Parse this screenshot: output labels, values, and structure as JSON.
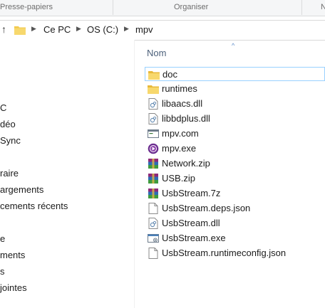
{
  "ribbon": {
    "groups": [
      "Presse-papiers",
      "Organiser",
      "N"
    ]
  },
  "address": {
    "up_glyph": "↑",
    "crumbs": [
      "Ce PC",
      "OS (C:)",
      "mpv"
    ]
  },
  "nav": {
    "items": [
      "C",
      "déo",
      "Sync",
      "raire",
      "argements",
      "cements récents",
      "e",
      "ments",
      "s",
      "jointes"
    ]
  },
  "column": {
    "name_header": "Nom",
    "sort_glyph": "^"
  },
  "files": [
    {
      "name": "doc",
      "icon": "folder-icon",
      "selected": true
    },
    {
      "name": "runtimes",
      "icon": "folder-icon",
      "selected": false
    },
    {
      "name": "libaacs.dll",
      "icon": "dll-file-icon",
      "selected": false
    },
    {
      "name": "libbdplus.dll",
      "icon": "dll-file-icon",
      "selected": false
    },
    {
      "name": "mpv.com",
      "icon": "console-app-icon",
      "selected": false
    },
    {
      "name": "mpv.exe",
      "icon": "mpv-app-icon",
      "selected": false
    },
    {
      "name": "Network.zip",
      "icon": "archive-icon",
      "selected": false
    },
    {
      "name": "USB.zip",
      "icon": "archive-icon",
      "selected": false
    },
    {
      "name": "UsbStream.7z",
      "icon": "archive-icon",
      "selected": false
    },
    {
      "name": "UsbStream.deps.json",
      "icon": "json-file-icon",
      "selected": false
    },
    {
      "name": "UsbStream.dll",
      "icon": "dll-file-icon",
      "selected": false
    },
    {
      "name": "UsbStream.exe",
      "icon": "exe-app-icon",
      "selected": false
    },
    {
      "name": "UsbStream.runtimeconfig.json",
      "icon": "json-file-icon",
      "selected": false
    }
  ],
  "colors": {
    "folder": "#f2c94c",
    "selection_border": "#99d1ff",
    "header_text": "#4c607a",
    "mpv_purple": "#6b2d8f"
  }
}
